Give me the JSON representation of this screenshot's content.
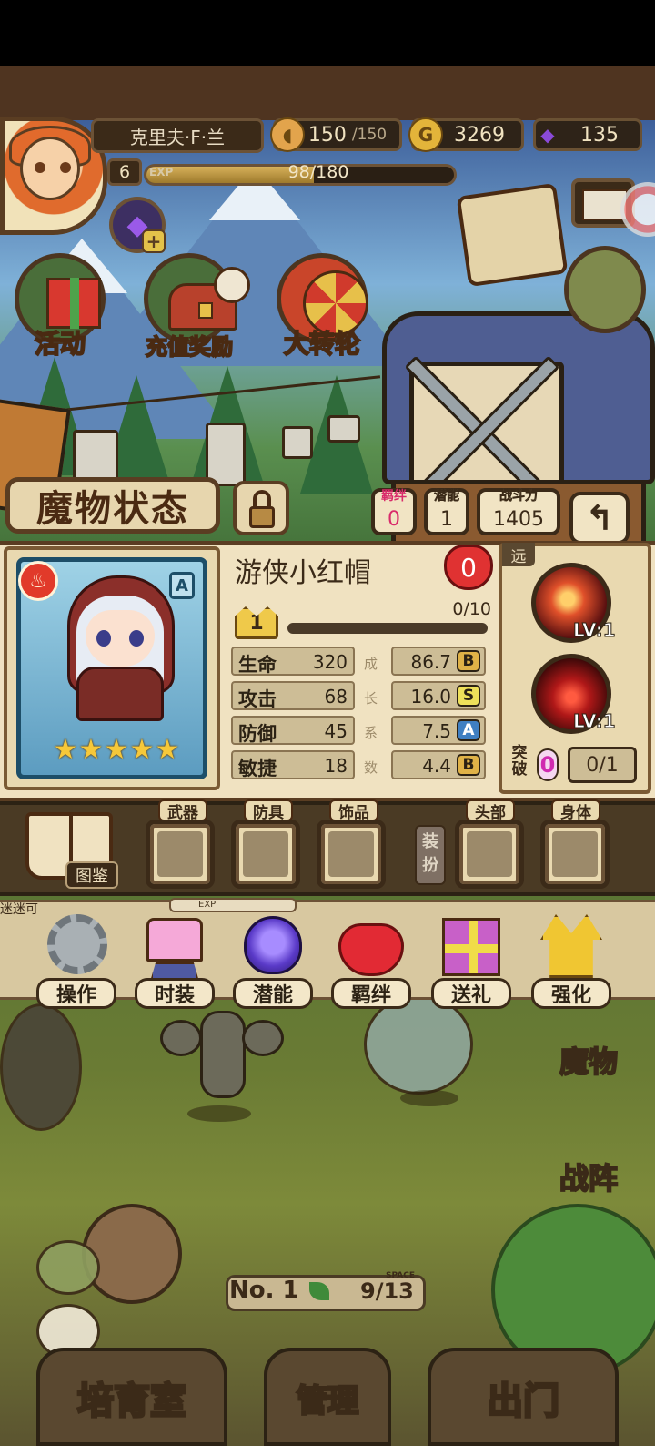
{
  "player": {
    "name": "克里夫·F·兰",
    "level": "6"
  },
  "exp": {
    "label": "EXP",
    "text": "98/180",
    "fraction": 0.544
  },
  "resources": {
    "stamina": {
      "current": "150",
      "max": "/150"
    },
    "gold": {
      "value": "3269"
    },
    "gems": {
      "value": "135"
    }
  },
  "events": [
    {
      "label": "活动"
    },
    {
      "label": "充值奖励"
    },
    {
      "label": "大转轮"
    }
  ],
  "status": {
    "title": "魔物状态",
    "bond": {
      "label": "羁绊",
      "value": "0"
    },
    "potential": {
      "label": "潜能",
      "value": "1"
    },
    "power": {
      "label": "战斗力",
      "value": "1405"
    },
    "back_icon": "↰"
  },
  "monster": {
    "name": "游侠小红帽",
    "heart": "0",
    "element_icon": "fire-icon",
    "rank": "A",
    "stars": 5,
    "level": "1",
    "level_progress": "0/10",
    "level_fraction": 0,
    "range": "远",
    "growth_chars": [
      "成",
      "长",
      "系",
      "数"
    ],
    "stats": [
      {
        "name": "生命",
        "value": "320",
        "growth": "86.7",
        "grade": "B"
      },
      {
        "name": "攻击",
        "value": "68",
        "growth": "16.0",
        "grade": "S"
      },
      {
        "name": "防御",
        "value": "45",
        "growth": "7.5",
        "grade": "A"
      },
      {
        "name": "敏捷",
        "value": "18",
        "growth": "4.4",
        "grade": "B"
      }
    ],
    "skills": [
      {
        "level": "LV:1"
      },
      {
        "level": "LV:1"
      }
    ],
    "breakthrough": {
      "label_top": "突",
      "label_bottom": "破",
      "count": "0",
      "progress": "0/1"
    }
  },
  "equipment": {
    "book_label": "图鉴",
    "slots": [
      {
        "label": "武器"
      },
      {
        "label": "防具"
      },
      {
        "label": "饰品"
      },
      {
        "label": "头部"
      },
      {
        "label": "身体"
      }
    ],
    "dress_label_top": "装",
    "dress_label_bottom": "扮"
  },
  "underlay": {
    "label": "迷迷可",
    "exp_label": "EXP"
  },
  "actions": [
    {
      "label": "操作"
    },
    {
      "label": "时装"
    },
    {
      "label": "潜能"
    },
    {
      "label": "羁绊"
    },
    {
      "label": "送礼"
    },
    {
      "label": "强化"
    }
  ],
  "side": {
    "monster": "魔物",
    "formation": "战阵"
  },
  "room": {
    "no_label": "No. 1",
    "space_label": "SPACE",
    "space": "9/13"
  },
  "nav": {
    "left": "培育室",
    "center": "管理",
    "right": "出门"
  },
  "colors": {
    "frame": "#5a3d22",
    "panel": "#f0e2c1",
    "gold": "#e3c24a",
    "accent_red": "#e03232",
    "grade_A": "#3f7fc2"
  }
}
